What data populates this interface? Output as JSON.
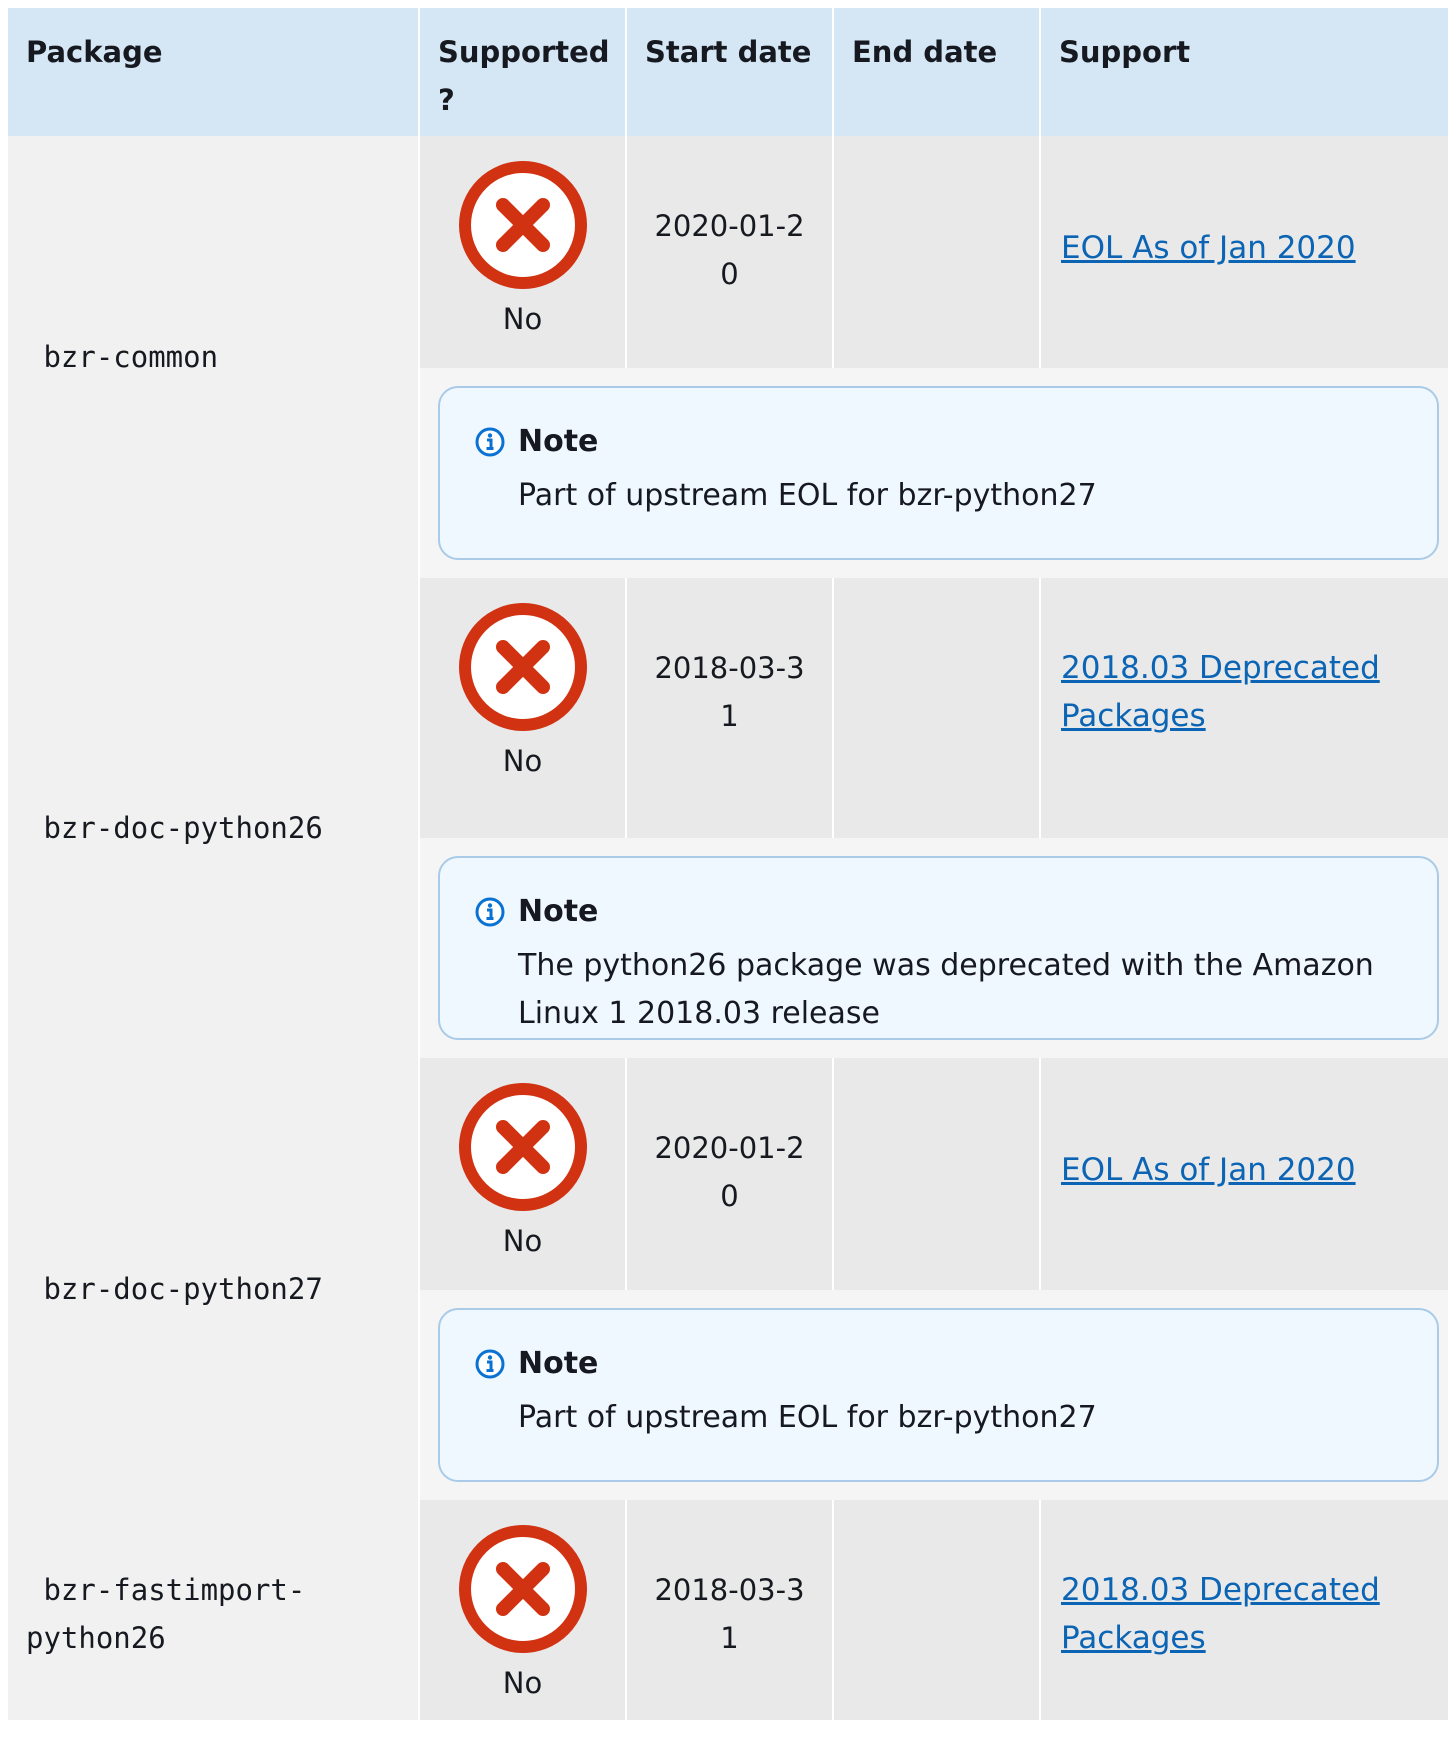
{
  "headers": [
    "Package",
    "Supported ?",
    "Start date",
    "End date",
    "Support"
  ],
  "note_title": "Note",
  "rows": [
    {
      "package": " bzr-common",
      "supported": "No",
      "start_date": "2020-01-20",
      "end_date": "",
      "support_link": "EOL As of Jan 2020",
      "note": "Part of upstream EOL for bzr-python27"
    },
    {
      "package": " bzr-doc-python26",
      "supported": "No",
      "start_date": "2018-03-31",
      "end_date": "",
      "support_link": "2018.03 Deprecated Packages",
      "note": "The python26 package was deprecated with the Amazon Linux 1 2018.03 release"
    },
    {
      "package": " bzr-doc-python27",
      "supported": "No",
      "start_date": "2020-01-20",
      "end_date": "",
      "support_link": "EOL As of Jan 2020",
      "note": "Part of upstream EOL for bzr-python27"
    },
    {
      "package": " bzr-fastimport-\npython26",
      "supported": "No",
      "start_date": "2018-03-31",
      "end_date": "",
      "support_link": "2018.03 Deprecated Packages",
      "note": ""
    }
  ],
  "icons": {
    "not_supported": "x-circle-icon",
    "note": "info-circle-icon"
  },
  "colors": {
    "header_bg": "#d5e6f5",
    "error_red": "#d13212",
    "link_blue": "#0b64b4",
    "note_border": "#a9cbe8"
  }
}
